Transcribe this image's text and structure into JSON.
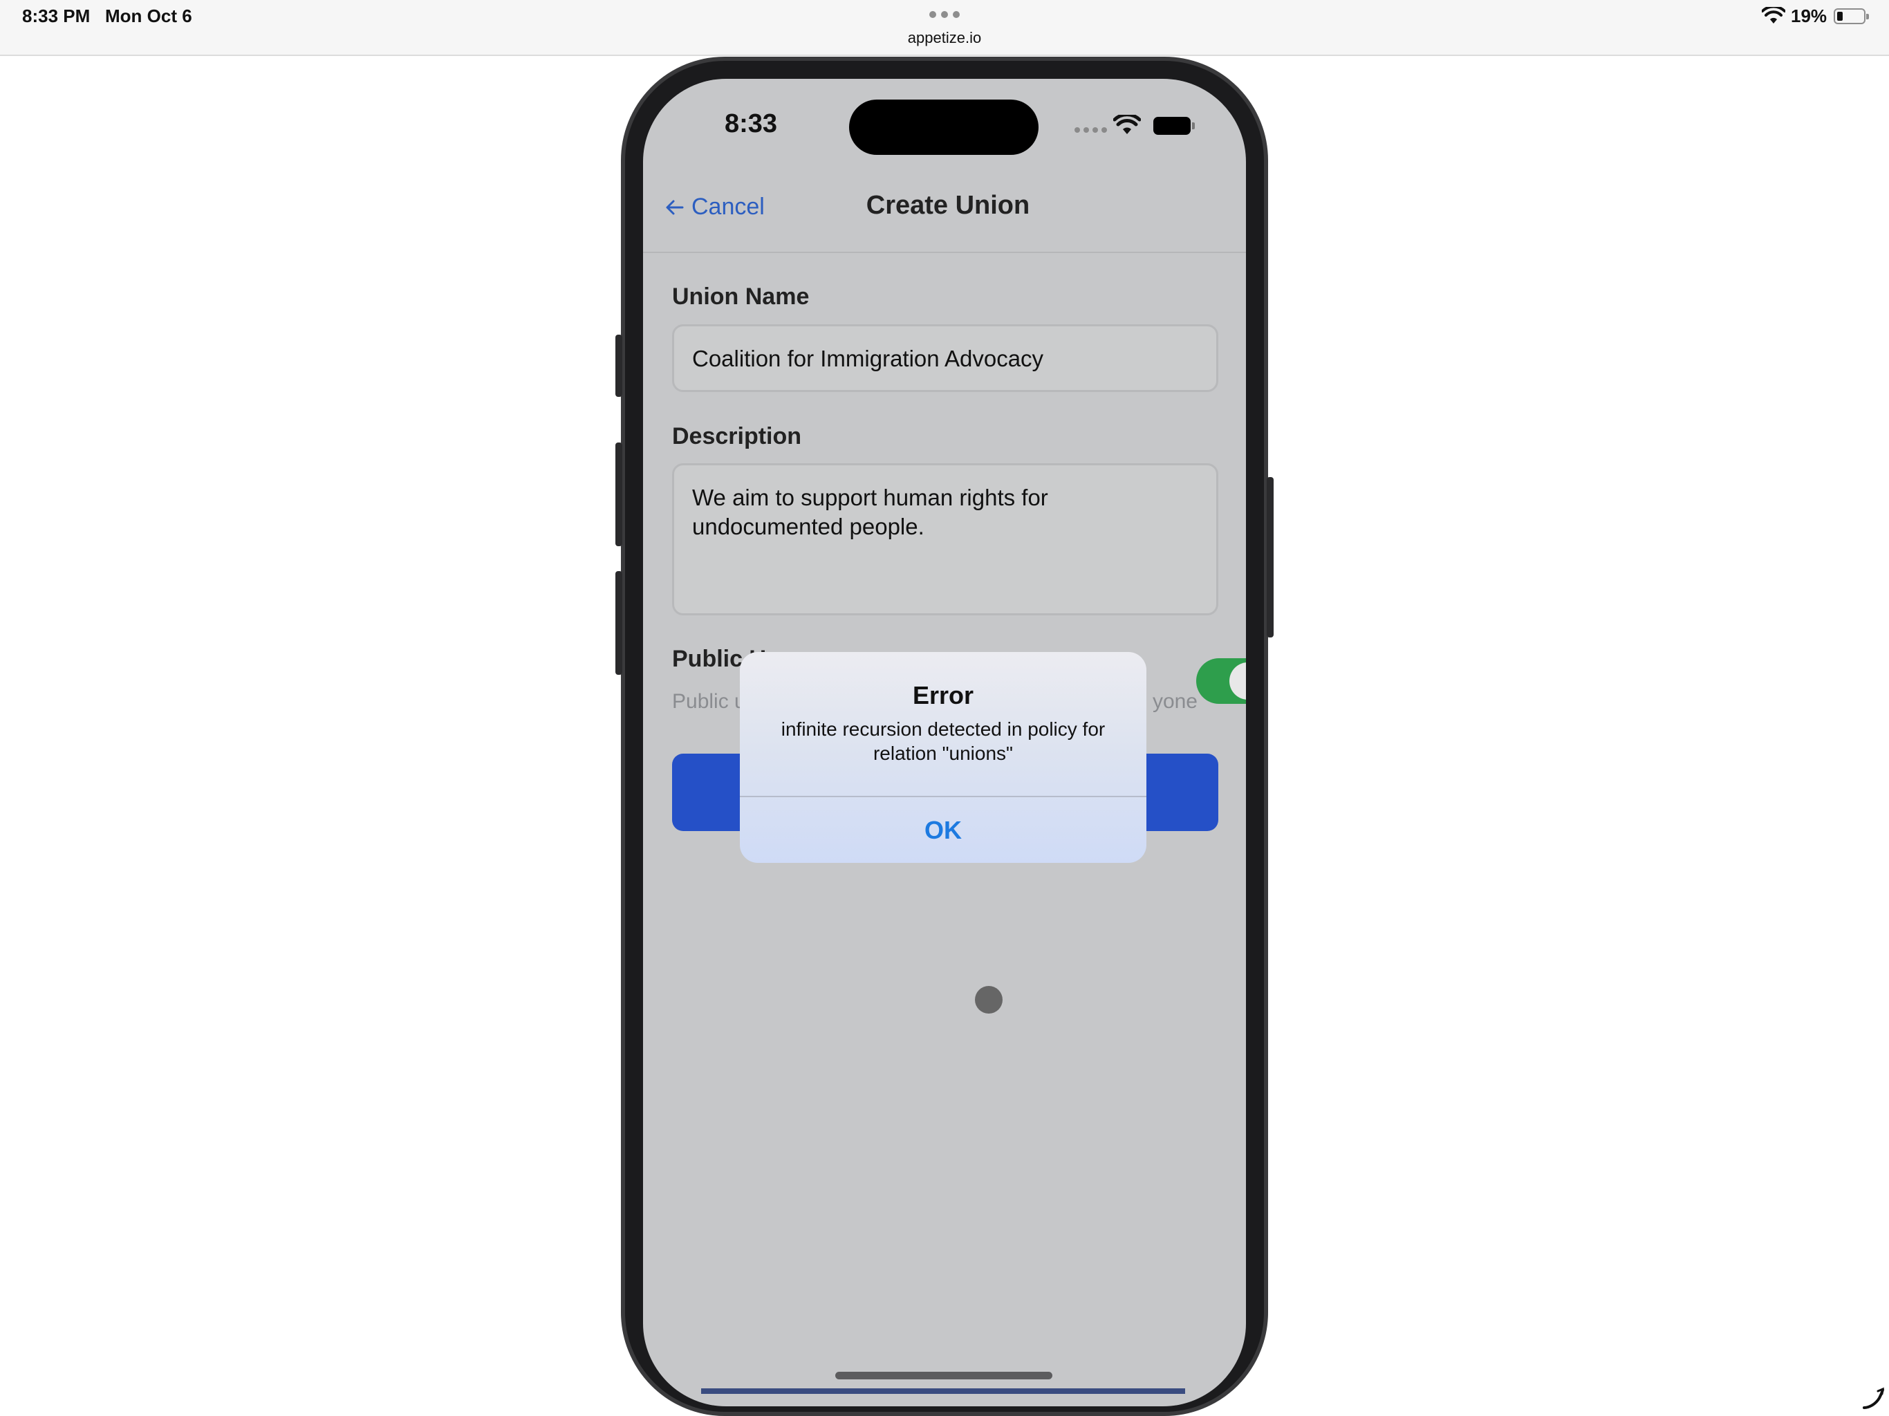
{
  "ipad_status": {
    "time": "8:33 PM",
    "date": "Mon Oct 6",
    "url": "appetize.io",
    "battery_percent": "19%",
    "battery_level": 0.19
  },
  "phone_status": {
    "time": "8:33"
  },
  "nav": {
    "cancel_label": "Cancel",
    "title": "Create Union"
  },
  "form": {
    "union_name_label": "Union Name",
    "union_name_value": "Coalition for Immigration Advocacy",
    "description_label": "Description",
    "description_value": "We aim to support human rights for undocumented people.",
    "public_label_visible": "Public U",
    "public_sub_left": "Public u",
    "public_sub_right": "yone",
    "public_toggle_on": true
  },
  "alert": {
    "title": "Error",
    "message": "infinite recursion detected in policy for relation \"unions\"",
    "ok_label": "OK"
  },
  "colors": {
    "accent": "#2550c7",
    "link": "#2c5ec0",
    "alert_button": "#1d7ae0",
    "toggle_on": "#2e9e4c"
  },
  "icons": [
    "wifi-icon",
    "battery-icon",
    "back-arrow-icon",
    "signal-icon",
    "phone-icon"
  ]
}
